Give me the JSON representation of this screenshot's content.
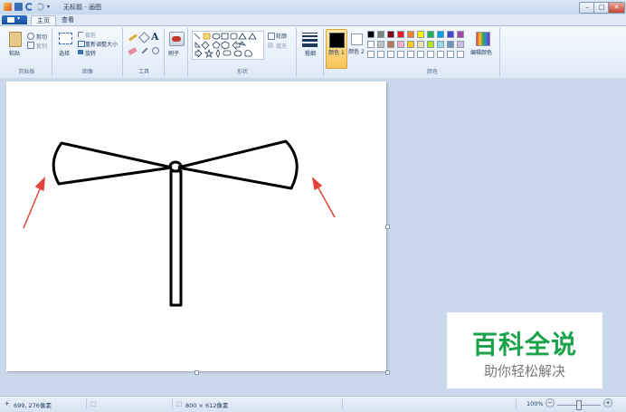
{
  "window": {
    "title": "无标题 - 画图",
    "min_btn": "–",
    "max_btn": "□",
    "close_btn": "✕"
  },
  "tabs": [
    {
      "label": "主页",
      "active": true
    },
    {
      "label": "查看",
      "active": false
    }
  ],
  "ribbon": {
    "clipboard": {
      "label": "剪贴板",
      "paste": "粘贴",
      "cut": "剪切",
      "copy": "复制"
    },
    "image": {
      "label": "图像",
      "select": "选择",
      "crop": "裁剪",
      "resize": "重新调整大小",
      "rotate": "旋转"
    },
    "tools": {
      "label": "工具"
    },
    "brushes": {
      "label": "刷子"
    },
    "shapes": {
      "label": "形状",
      "outline": "轮廓",
      "fill": "填充"
    },
    "size": {
      "label": "粗细"
    },
    "color1": {
      "label": "颜色 1",
      "color": "#000000"
    },
    "color2": {
      "label": "颜色 2",
      "color": "#ffffff"
    },
    "colors": {
      "label": "颜色",
      "edit": "编辑颜色",
      "palette_row1": [
        "#000000",
        "#7f7f7f",
        "#880015",
        "#ed1c24",
        "#ff7f27",
        "#fff200",
        "#22b14c",
        "#00a2e8",
        "#3f48cc",
        "#a349a4"
      ],
      "palette_row2": [
        "#ffffff",
        "#c3c3c3",
        "#b97a57",
        "#ffaec9",
        "#ffc90e",
        "#efe4b0",
        "#b5e61d",
        "#99d9ea",
        "#7092be",
        "#c8bfe7"
      ],
      "palette_row3": [
        "#ffffff",
        "#ffffff",
        "#ffffff",
        "#ffffff",
        "#ffffff",
        "#ffffff",
        "#ffffff",
        "#ffffff",
        "#ffffff",
        "#ffffff"
      ]
    }
  },
  "status": {
    "cursor_pos": "699, 276像素",
    "canvas_size": "800 × 612像素",
    "zoom": "100%"
  },
  "watermark": {
    "title": "百科全说",
    "subtitle": "助你轻松解决"
  }
}
